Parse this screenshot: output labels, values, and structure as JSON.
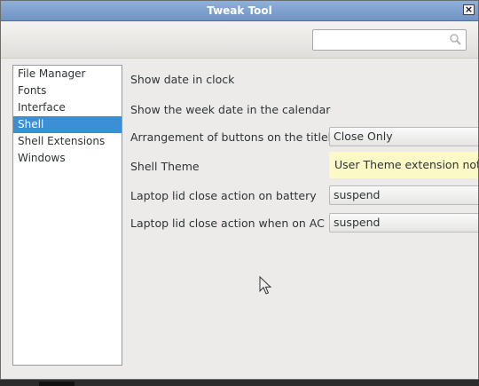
{
  "window": {
    "title": "Tweak Tool"
  },
  "search": {
    "value": "",
    "placeholder": ""
  },
  "sidebar": {
    "items": [
      {
        "label": "File Manager"
      },
      {
        "label": "Fonts"
      },
      {
        "label": "Interface"
      },
      {
        "label": "Shell",
        "selected": true
      },
      {
        "label": "Shell Extensions"
      },
      {
        "label": "Windows"
      }
    ]
  },
  "shell": {
    "show_date": {
      "label": "Show date in clock"
    },
    "show_week_date": {
      "label": "Show the week date in the calendar"
    },
    "titlebar_buttons": {
      "label": "Arrangement of buttons on the titlebar",
      "value": "Close Only"
    },
    "shell_theme": {
      "label": "Shell Theme",
      "value": "User Theme extension not"
    },
    "lid_battery": {
      "label": "Laptop lid close action on battery",
      "value": "suspend"
    },
    "lid_ac": {
      "label": "Laptop lid close action when on AC",
      "value": "suspend"
    }
  },
  "colors": {
    "selection": "#3b8fd6",
    "titlebar": "#7a9dcc",
    "warning_bg": "#fbfac7"
  },
  "icons": {
    "close": "close-icon",
    "search": "search-icon"
  }
}
